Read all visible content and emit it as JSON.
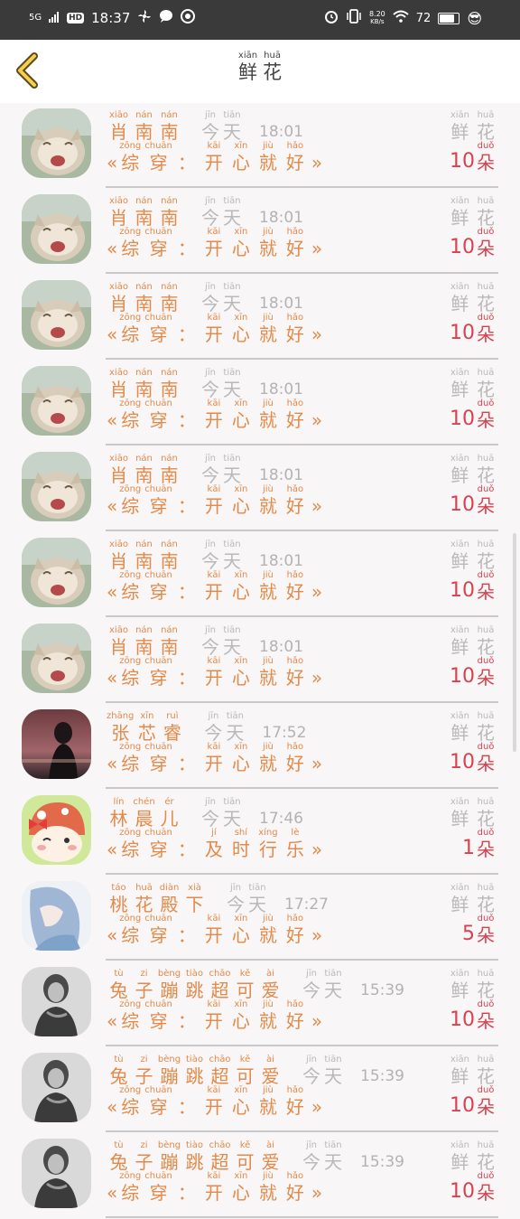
{
  "status": {
    "signal": "5G",
    "hd": "HD",
    "time": "18:37",
    "speed_value": "8.20",
    "speed_unit": "KB/s",
    "battery": "72",
    "battery_pct": 0.72
  },
  "header": {
    "title": [
      {
        "py": "xiān",
        "ch": "鲜"
      },
      {
        "py": "huā",
        "ch": "花"
      }
    ]
  },
  "list_labels": {
    "today": [
      {
        "py": "jīn",
        "ch": "今"
      },
      {
        "py": "tiān",
        "ch": "天"
      }
    ],
    "flowers": [
      {
        "py": "xiān",
        "ch": "鲜"
      },
      {
        "py": "huā",
        "ch": "花"
      }
    ],
    "unit": {
      "py": "duǒ",
      "ch": "朵"
    },
    "open_quote": "«",
    "close_quote": "»"
  },
  "rows": [
    {
      "name": [
        {
          "py": "xiāo",
          "ch": "肖"
        },
        {
          "py": "nán",
          "ch": "南"
        },
        {
          "py": "nán",
          "ch": "南"
        }
      ],
      "time": "18:01",
      "book": [
        {
          "py": "zōng",
          "ch": "综"
        },
        {
          "py": "chuān",
          "ch": "穿"
        },
        {
          "py": "",
          "ch": "："
        },
        {
          "py": "kāi",
          "ch": "开"
        },
        {
          "py": "xīn",
          "ch": "心"
        },
        {
          "py": "jiù",
          "ch": "就"
        },
        {
          "py": "hǎo",
          "ch": "好"
        }
      ],
      "count": "10",
      "avatar": "cat"
    },
    {
      "name": [
        {
          "py": "xiāo",
          "ch": "肖"
        },
        {
          "py": "nán",
          "ch": "南"
        },
        {
          "py": "nán",
          "ch": "南"
        }
      ],
      "time": "18:01",
      "book": [
        {
          "py": "zōng",
          "ch": "综"
        },
        {
          "py": "chuān",
          "ch": "穿"
        },
        {
          "py": "",
          "ch": "："
        },
        {
          "py": "kāi",
          "ch": "开"
        },
        {
          "py": "xīn",
          "ch": "心"
        },
        {
          "py": "jiù",
          "ch": "就"
        },
        {
          "py": "hǎo",
          "ch": "好"
        }
      ],
      "count": "10",
      "avatar": "cat"
    },
    {
      "name": [
        {
          "py": "xiāo",
          "ch": "肖"
        },
        {
          "py": "nán",
          "ch": "南"
        },
        {
          "py": "nán",
          "ch": "南"
        }
      ],
      "time": "18:01",
      "book": [
        {
          "py": "zōng",
          "ch": "综"
        },
        {
          "py": "chuān",
          "ch": "穿"
        },
        {
          "py": "",
          "ch": "："
        },
        {
          "py": "kāi",
          "ch": "开"
        },
        {
          "py": "xīn",
          "ch": "心"
        },
        {
          "py": "jiù",
          "ch": "就"
        },
        {
          "py": "hǎo",
          "ch": "好"
        }
      ],
      "count": "10",
      "avatar": "cat"
    },
    {
      "name": [
        {
          "py": "xiāo",
          "ch": "肖"
        },
        {
          "py": "nán",
          "ch": "南"
        },
        {
          "py": "nán",
          "ch": "南"
        }
      ],
      "time": "18:01",
      "book": [
        {
          "py": "zōng",
          "ch": "综"
        },
        {
          "py": "chuān",
          "ch": "穿"
        },
        {
          "py": "",
          "ch": "："
        },
        {
          "py": "kāi",
          "ch": "开"
        },
        {
          "py": "xīn",
          "ch": "心"
        },
        {
          "py": "jiù",
          "ch": "就"
        },
        {
          "py": "hǎo",
          "ch": "好"
        }
      ],
      "count": "10",
      "avatar": "cat"
    },
    {
      "name": [
        {
          "py": "xiāo",
          "ch": "肖"
        },
        {
          "py": "nán",
          "ch": "南"
        },
        {
          "py": "nán",
          "ch": "南"
        }
      ],
      "time": "18:01",
      "book": [
        {
          "py": "zōng",
          "ch": "综"
        },
        {
          "py": "chuān",
          "ch": "穿"
        },
        {
          "py": "",
          "ch": "："
        },
        {
          "py": "kāi",
          "ch": "开"
        },
        {
          "py": "xīn",
          "ch": "心"
        },
        {
          "py": "jiù",
          "ch": "就"
        },
        {
          "py": "hǎo",
          "ch": "好"
        }
      ],
      "count": "10",
      "avatar": "cat"
    },
    {
      "name": [
        {
          "py": "xiāo",
          "ch": "肖"
        },
        {
          "py": "nán",
          "ch": "南"
        },
        {
          "py": "nán",
          "ch": "南"
        }
      ],
      "time": "18:01",
      "book": [
        {
          "py": "zōng",
          "ch": "综"
        },
        {
          "py": "chuān",
          "ch": "穿"
        },
        {
          "py": "",
          "ch": "："
        },
        {
          "py": "kāi",
          "ch": "开"
        },
        {
          "py": "xīn",
          "ch": "心"
        },
        {
          "py": "jiù",
          "ch": "就"
        },
        {
          "py": "hǎo",
          "ch": "好"
        }
      ],
      "count": "10",
      "avatar": "cat"
    },
    {
      "name": [
        {
          "py": "xiāo",
          "ch": "肖"
        },
        {
          "py": "nán",
          "ch": "南"
        },
        {
          "py": "nán",
          "ch": "南"
        }
      ],
      "time": "18:01",
      "book": [
        {
          "py": "zōng",
          "ch": "综"
        },
        {
          "py": "chuān",
          "ch": "穿"
        },
        {
          "py": "",
          "ch": "："
        },
        {
          "py": "kāi",
          "ch": "开"
        },
        {
          "py": "xīn",
          "ch": "心"
        },
        {
          "py": "jiù",
          "ch": "就"
        },
        {
          "py": "hǎo",
          "ch": "好"
        }
      ],
      "count": "10",
      "avatar": "cat"
    },
    {
      "name": [
        {
          "py": "zhāng",
          "ch": "张"
        },
        {
          "py": "xīn",
          "ch": "芯"
        },
        {
          "py": "ruì",
          "ch": "睿"
        }
      ],
      "time": "17:52",
      "book": [
        {
          "py": "zōng",
          "ch": "综"
        },
        {
          "py": "chuān",
          "ch": "穿"
        },
        {
          "py": "",
          "ch": "："
        },
        {
          "py": "kāi",
          "ch": "开"
        },
        {
          "py": "xīn",
          "ch": "心"
        },
        {
          "py": "jiù",
          "ch": "就"
        },
        {
          "py": "hǎo",
          "ch": "好"
        }
      ],
      "count": "10",
      "avatar": "girl"
    },
    {
      "name": [
        {
          "py": "lín",
          "ch": "林"
        },
        {
          "py": "chén",
          "ch": "晨"
        },
        {
          "py": "ér",
          "ch": "儿"
        }
      ],
      "time": "17:46",
      "book": [
        {
          "py": "zōng",
          "ch": "综"
        },
        {
          "py": "chuān",
          "ch": "穿"
        },
        {
          "py": "",
          "ch": "："
        },
        {
          "py": "jí",
          "ch": "及"
        },
        {
          "py": "shí",
          "ch": "时"
        },
        {
          "py": "xíng",
          "ch": "行"
        },
        {
          "py": "lè",
          "ch": "乐"
        }
      ],
      "count": "1",
      "avatar": "cartoon"
    },
    {
      "name": [
        {
          "py": "táo",
          "ch": "桃"
        },
        {
          "py": "huā",
          "ch": "花"
        },
        {
          "py": "diàn",
          "ch": "殿"
        },
        {
          "py": "xià",
          "ch": "下"
        }
      ],
      "time": "17:27",
      "book": [
        {
          "py": "zōng",
          "ch": "综"
        },
        {
          "py": "chuān",
          "ch": "穿"
        },
        {
          "py": "",
          "ch": "："
        },
        {
          "py": "kāi",
          "ch": "开"
        },
        {
          "py": "xīn",
          "ch": "心"
        },
        {
          "py": "jiù",
          "ch": "就"
        },
        {
          "py": "hǎo",
          "ch": "好"
        }
      ],
      "count": "5",
      "avatar": "anime"
    },
    {
      "name": [
        {
          "py": "tù",
          "ch": "兔"
        },
        {
          "py": "zi",
          "ch": "子"
        },
        {
          "py": "bèng",
          "ch": "蹦"
        },
        {
          "py": "tiào",
          "ch": "跳"
        },
        {
          "py": "chāo",
          "ch": "超"
        },
        {
          "py": "kě",
          "ch": "可"
        },
        {
          "py": "ài",
          "ch": "爱"
        }
      ],
      "time": "15:39",
      "book": [
        {
          "py": "zōng",
          "ch": "综"
        },
        {
          "py": "chuān",
          "ch": "穿"
        },
        {
          "py": "",
          "ch": "："
        },
        {
          "py": "kāi",
          "ch": "开"
        },
        {
          "py": "xīn",
          "ch": "心"
        },
        {
          "py": "jiù",
          "ch": "就"
        },
        {
          "py": "hǎo",
          "ch": "好"
        }
      ],
      "count": "10",
      "avatar": "bw"
    },
    {
      "name": [
        {
          "py": "tù",
          "ch": "兔"
        },
        {
          "py": "zi",
          "ch": "子"
        },
        {
          "py": "bèng",
          "ch": "蹦"
        },
        {
          "py": "tiào",
          "ch": "跳"
        },
        {
          "py": "chāo",
          "ch": "超"
        },
        {
          "py": "kě",
          "ch": "可"
        },
        {
          "py": "ài",
          "ch": "爱"
        }
      ],
      "time": "15:39",
      "book": [
        {
          "py": "zōng",
          "ch": "综"
        },
        {
          "py": "chuān",
          "ch": "穿"
        },
        {
          "py": "",
          "ch": "："
        },
        {
          "py": "kāi",
          "ch": "开"
        },
        {
          "py": "xīn",
          "ch": "心"
        },
        {
          "py": "jiù",
          "ch": "就"
        },
        {
          "py": "hǎo",
          "ch": "好"
        }
      ],
      "count": "10",
      "avatar": "bw"
    },
    {
      "name": [
        {
          "py": "tù",
          "ch": "兔"
        },
        {
          "py": "zi",
          "ch": "子"
        },
        {
          "py": "bèng",
          "ch": "蹦"
        },
        {
          "py": "tiào",
          "ch": "跳"
        },
        {
          "py": "chāo",
          "ch": "超"
        },
        {
          "py": "kě",
          "ch": "可"
        },
        {
          "py": "ài",
          "ch": "爱"
        }
      ],
      "time": "15:39",
      "book": [
        {
          "py": "zōng",
          "ch": "综"
        },
        {
          "py": "chuān",
          "ch": "穿"
        },
        {
          "py": "",
          "ch": "："
        },
        {
          "py": "kāi",
          "ch": "开"
        },
        {
          "py": "xīn",
          "ch": "心"
        },
        {
          "py": "jiù",
          "ch": "就"
        },
        {
          "py": "hǎo",
          "ch": "好"
        }
      ],
      "count": "10",
      "avatar": "bw"
    }
  ]
}
